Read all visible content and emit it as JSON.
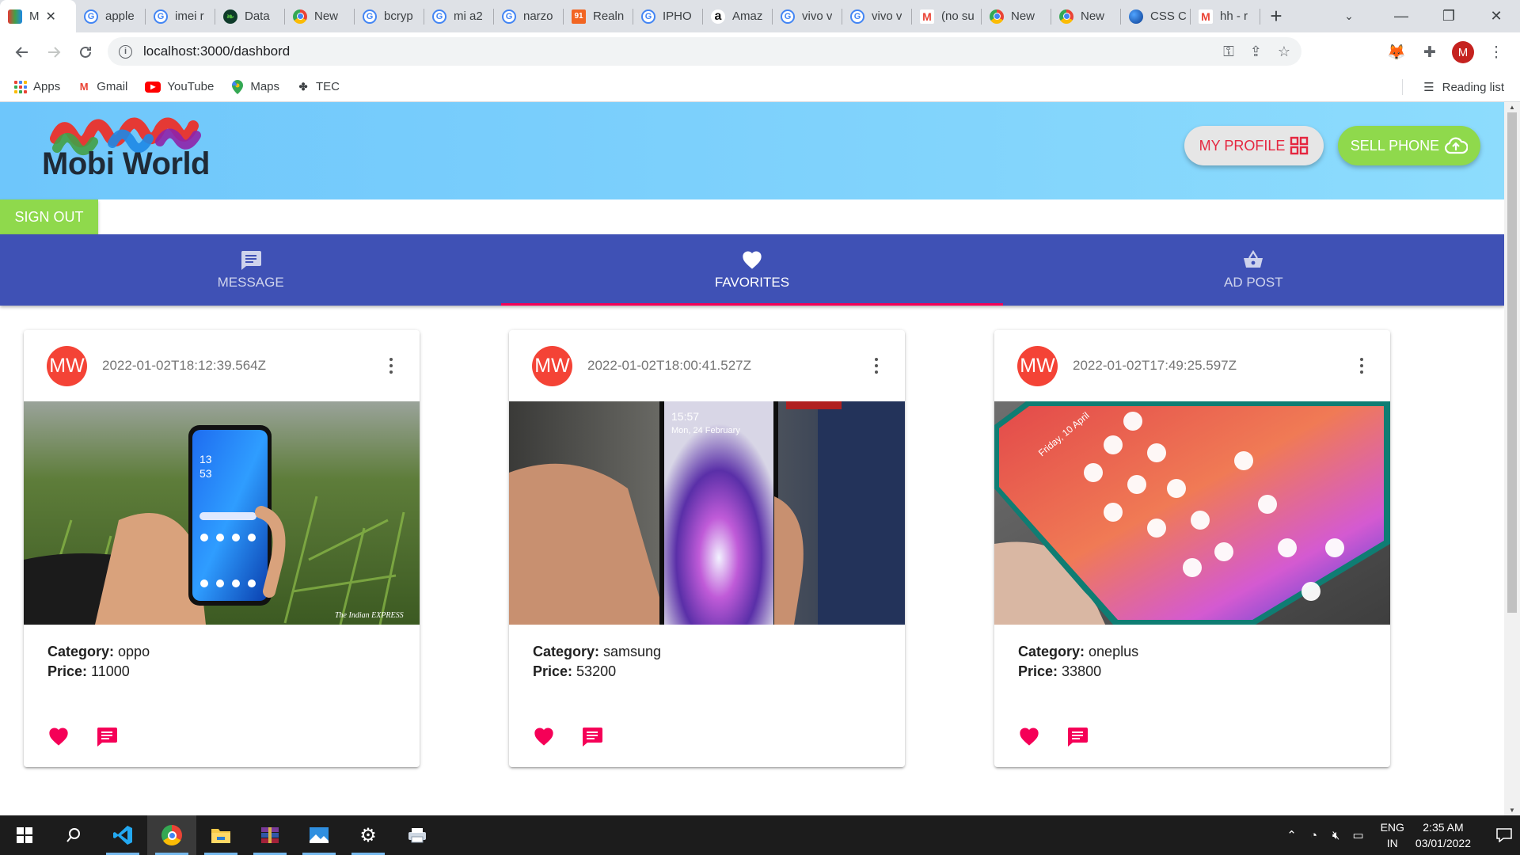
{
  "browser": {
    "tabs": [
      {
        "icon": "mw",
        "label": "M",
        "active": true
      },
      {
        "icon": "g",
        "label": "apple"
      },
      {
        "icon": "g",
        "label": "imei r"
      },
      {
        "icon": "leaf",
        "label": "Data"
      },
      {
        "icon": "chrome",
        "label": "New"
      },
      {
        "icon": "g",
        "label": "bcryp"
      },
      {
        "icon": "g",
        "label": "mi a2"
      },
      {
        "icon": "g",
        "label": "narzo"
      },
      {
        "icon": "s91",
        "label": "Realn"
      },
      {
        "icon": "g",
        "label": "IPHO"
      },
      {
        "icon": "amz",
        "label": "Amaz"
      },
      {
        "icon": "g",
        "label": "vivo v"
      },
      {
        "icon": "g",
        "label": "vivo v"
      },
      {
        "icon": "gmail",
        "label": "(no su"
      },
      {
        "icon": "chrome",
        "label": "New"
      },
      {
        "icon": "chrome",
        "label": "New"
      },
      {
        "icon": "globe",
        "label": "CSS C"
      },
      {
        "icon": "gmail",
        "label": "hh - r"
      }
    ],
    "url": "localhost:3000/dashbord",
    "profile_initial": "M",
    "bookmarks": [
      {
        "icon": "apps-grid-icon",
        "label": "Apps"
      },
      {
        "icon": "gmail-icon",
        "label": "Gmail"
      },
      {
        "icon": "youtube-icon",
        "label": "YouTube"
      },
      {
        "icon": "maps-icon",
        "label": "Maps"
      },
      {
        "icon": "tec-icon",
        "label": "TEC"
      }
    ],
    "reading_list": "Reading list"
  },
  "header": {
    "logo_text": "Mobi World",
    "my_profile_label": "MY PROFILE",
    "sell_phone_label": "SELL PHONE",
    "sign_out_label": "SIGN OUT"
  },
  "nav_tabs": [
    {
      "icon": "message-icon",
      "label": "MESSAGE",
      "selected": false
    },
    {
      "icon": "heart-icon",
      "label": "FAVORITES",
      "selected": true
    },
    {
      "icon": "basket-icon",
      "label": "AD POST",
      "selected": false
    }
  ],
  "cards": [
    {
      "avatar": "MW",
      "timestamp": "2022-01-02T18:12:39.564Z",
      "category_label": "Category:",
      "category": "oppo",
      "price_label": "Price:",
      "price": "11000",
      "image_credit": "The Indian EXPRESS",
      "favorited": true
    },
    {
      "avatar": "MW",
      "timestamp": "2022-01-02T18:00:41.527Z",
      "category_label": "Category:",
      "category": "samsung",
      "price_label": "Price:",
      "price": "53200",
      "image_screen_time": "15:57",
      "image_screen_date": "Mon, 24 February",
      "favorited": true
    },
    {
      "avatar": "MW",
      "timestamp": "2022-01-02T17:49:25.597Z",
      "category_label": "Category:",
      "category": "oneplus",
      "price_label": "Price:",
      "price": "33800",
      "image_screen_date": "Friday, 10 April",
      "favorited": true
    }
  ],
  "taskbar": {
    "apps": [
      "windows-start-icon",
      "search-icon",
      "vscode-icon",
      "chrome-icon",
      "file-explorer-icon",
      "winrar-icon",
      "photos-icon",
      "settings-icon",
      "printer-icon"
    ],
    "lang_top": "ENG",
    "lang_bottom": "IN",
    "time": "2:35 AM",
    "date": "03/01/2022"
  },
  "colors": {
    "accent_pink": "#f50057",
    "nav_blue": "#3f51b5",
    "green_button": "#8fd94c",
    "avatar_red": "#f44336"
  }
}
